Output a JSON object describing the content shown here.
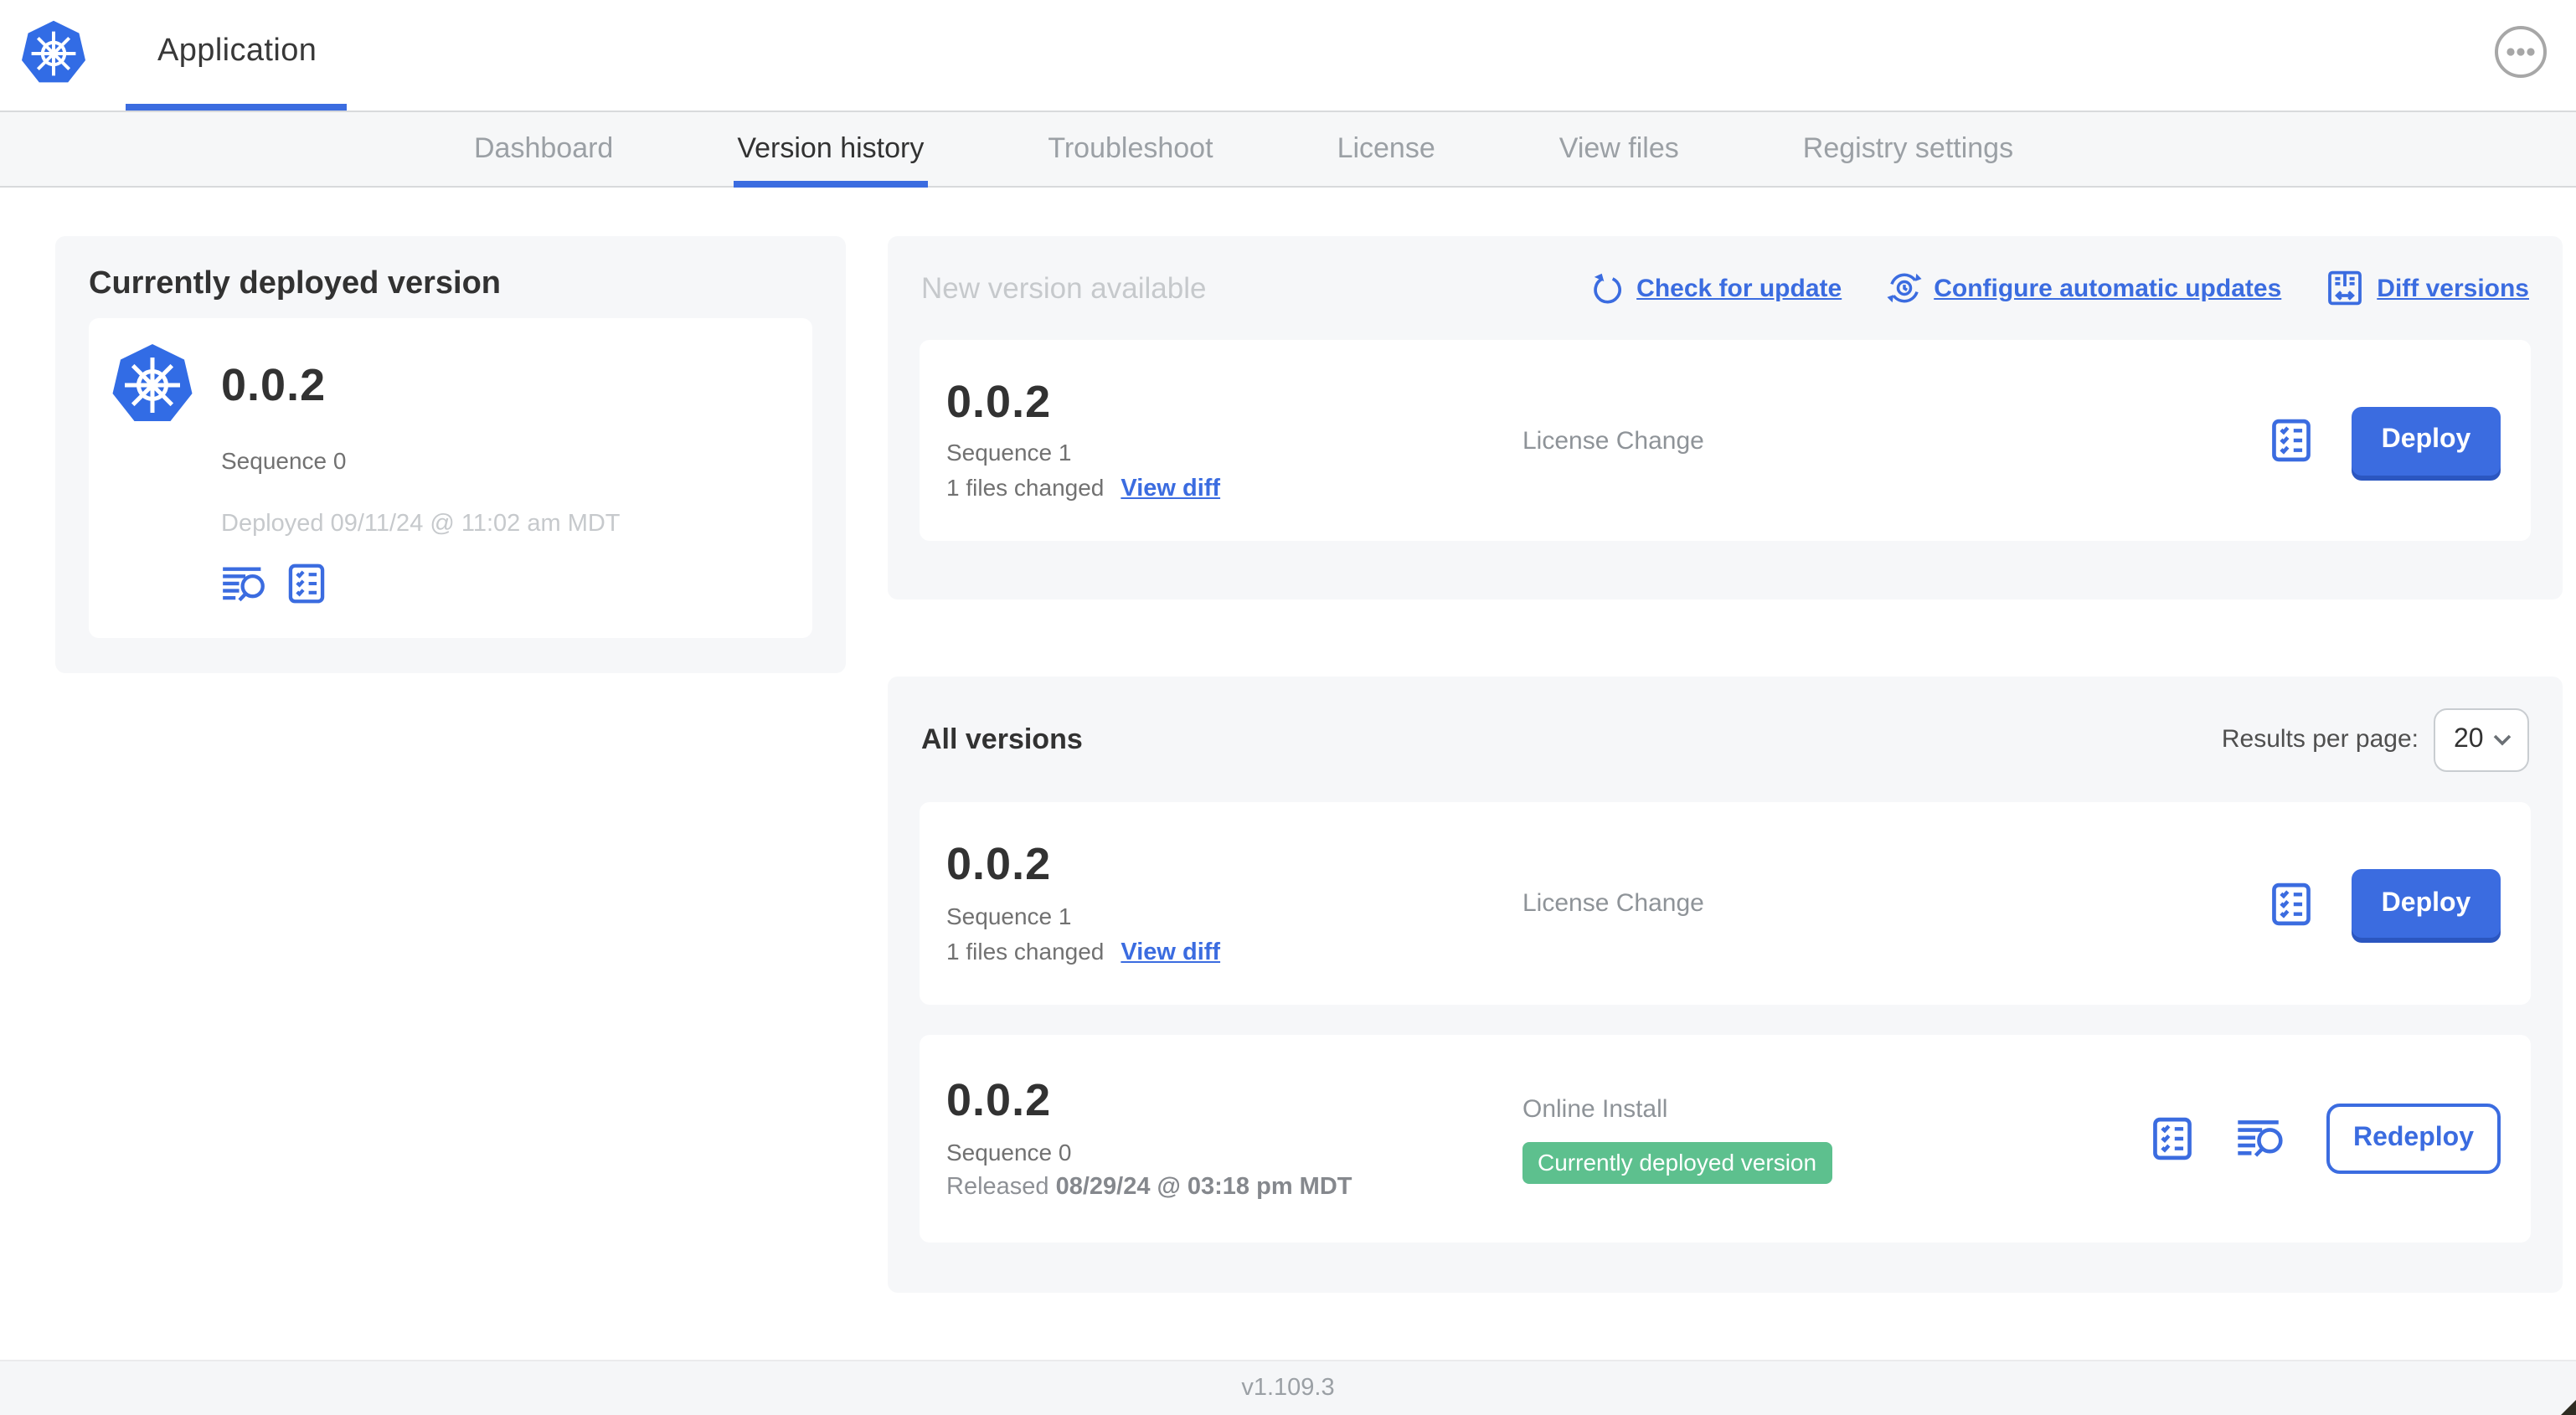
{
  "colors": {
    "accent": "#3b6ce0",
    "k8s_blue": "#326ce5",
    "badge_green": "#5dc08e",
    "dark_text": "#323232",
    "gray_text": "#9ba0a5",
    "light_text": "#c6c9cc"
  },
  "header": {
    "app_title": "Application"
  },
  "nav": {
    "tabs": [
      {
        "label": "Dashboard",
        "active": false
      },
      {
        "label": "Version history",
        "active": true
      },
      {
        "label": "Troubleshoot",
        "active": false
      },
      {
        "label": "License",
        "active": false
      },
      {
        "label": "View files",
        "active": false
      },
      {
        "label": "Registry settings",
        "active": false
      }
    ]
  },
  "current_version_panel": {
    "title": "Currently deployed version",
    "version": "0.0.2",
    "sequence": "Sequence 0",
    "deployed": "Deployed 09/11/24 @ 11:02 am MDT",
    "icons": [
      "logs-icon",
      "checklist-icon"
    ]
  },
  "new_version_panel": {
    "title": "New version available",
    "links": [
      {
        "icon": "refresh-icon",
        "label": "Check for update"
      },
      {
        "icon": "auto-update-icon",
        "label": "Configure automatic updates"
      },
      {
        "icon": "diff-icon",
        "label": "Diff versions"
      }
    ],
    "row": {
      "version": "0.0.2",
      "sequence": "Sequence 1",
      "files_changed": "1 files changed",
      "view_diff_label": "View diff",
      "change_type": "License Change",
      "deploy_label": "Deploy"
    }
  },
  "all_versions_panel": {
    "title": "All versions",
    "results_per_page_label": "Results per page:",
    "results_per_page_value": "20",
    "rows": [
      {
        "version": "0.0.2",
        "sequence": "Sequence 1",
        "files_changed": "1 files changed",
        "view_diff_label": "View diff",
        "change_type": "License Change",
        "action_label": "Deploy"
      },
      {
        "version": "0.0.2",
        "sequence": "Sequence 0",
        "released_prefix": "Released",
        "released_date": "08/29/24 @ 03:18 pm MDT",
        "install_type": "Online Install",
        "badge": "Currently deployed version",
        "action_label": "Redeploy"
      }
    ]
  },
  "footer": {
    "app_version": "v1.109.3"
  }
}
